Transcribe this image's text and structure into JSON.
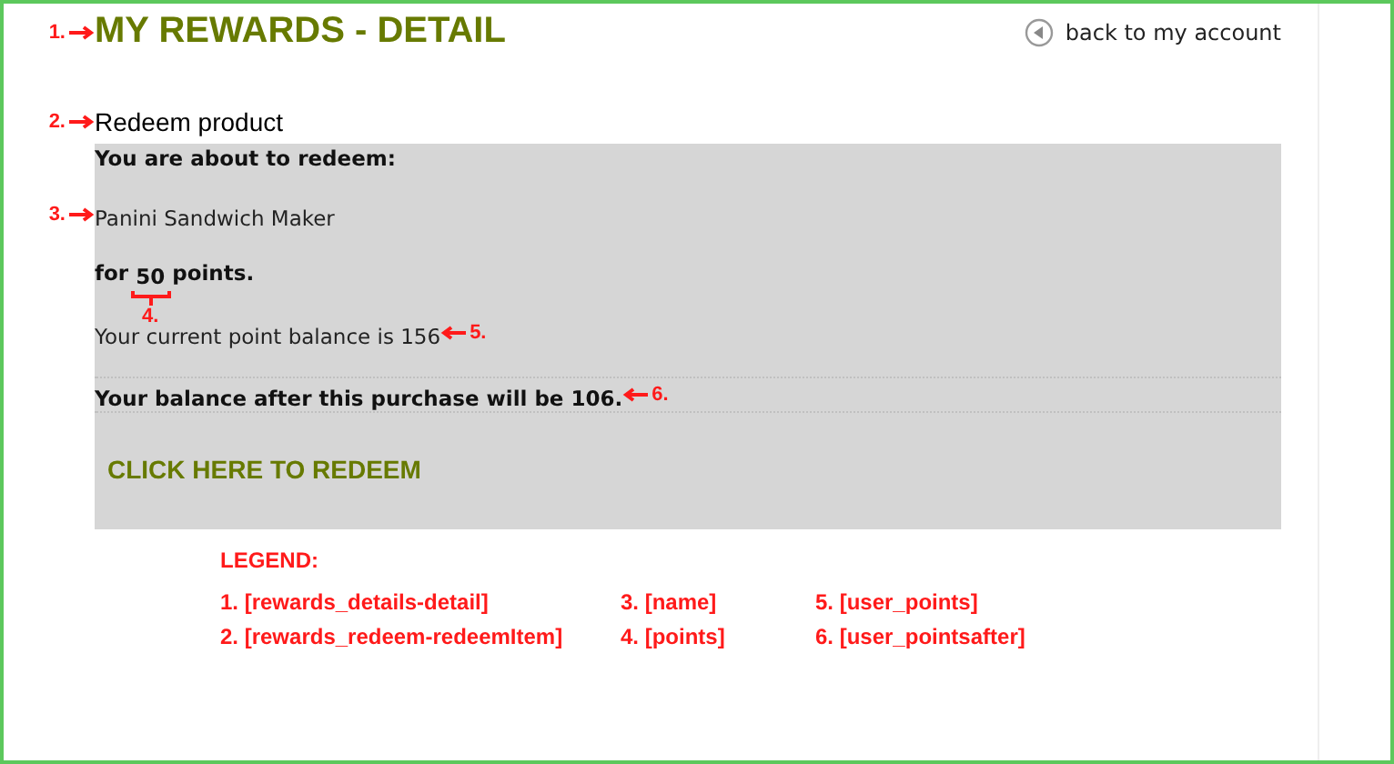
{
  "title": {
    "text": "MY REWARDS - DETAIL",
    "marker": "1."
  },
  "back_link": {
    "text": "back to my account"
  },
  "section": {
    "text": "Redeem product",
    "marker": "2."
  },
  "panel": {
    "intro": "You are about to redeem:",
    "product": {
      "text": "Panini Sandwich Maker",
      "marker": "3."
    },
    "points_line": {
      "before": "for",
      "value": "50",
      "after": "points.",
      "marker": "4."
    },
    "balance": {
      "text": "Your current point balance is 156",
      "marker": "5."
    },
    "after": {
      "text": "Your balance after this purchase will be 106.",
      "marker": "6."
    },
    "redeem_button": "CLICK HERE TO REDEEM"
  },
  "legend": {
    "title": "LEGEND:",
    "columns": [
      [
        "1. [rewards_details-detail]",
        "2. [rewards_redeem-redeemItem]"
      ],
      [
        "3. [name]",
        "4. [points]"
      ],
      [
        "5. [user_points]",
        "6. [user_pointsafter]"
      ]
    ]
  }
}
